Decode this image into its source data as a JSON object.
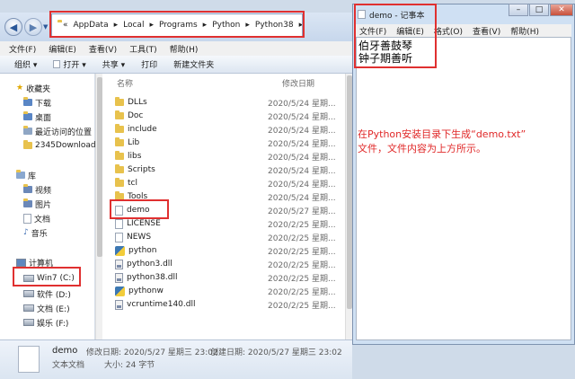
{
  "address_bar": {
    "overflow": "«",
    "segments": [
      "AppData",
      "Local",
      "Programs",
      "Python",
      "Python38"
    ]
  },
  "menu": [
    "文件(F)",
    "编辑(E)",
    "查看(V)",
    "工具(T)",
    "帮助(H)"
  ],
  "toolbar": {
    "organize": "组织 ▾",
    "open": "打开 ▾",
    "share": "共享 ▾",
    "print": "打印",
    "new_folder": "新建文件夹"
  },
  "nav": {
    "favorites": "收藏夹",
    "fav_items": [
      "下载",
      "桌面",
      "最近访问的位置",
      "2345Downloads"
    ],
    "library": "库",
    "lib_items": [
      "视频",
      "图片",
      "文档",
      "音乐"
    ],
    "computer": "计算机",
    "drives": [
      "Win7 (C:)",
      "软件 (D:)",
      "文档 (E:)",
      "娱乐 (F:)"
    ]
  },
  "columns": {
    "name": "名称",
    "date": "修改日期"
  },
  "files": [
    {
      "name": "DLLs",
      "date": "2020/5/24 星期...",
      "kind": "folder"
    },
    {
      "name": "Doc",
      "date": "2020/5/24 星期...",
      "kind": "folder"
    },
    {
      "name": "include",
      "date": "2020/5/24 星期...",
      "kind": "folder"
    },
    {
      "name": "Lib",
      "date": "2020/5/24 星期...",
      "kind": "folder"
    },
    {
      "name": "libs",
      "date": "2020/5/24 星期...",
      "kind": "folder"
    },
    {
      "name": "Scripts",
      "date": "2020/5/24 星期...",
      "kind": "folder"
    },
    {
      "name": "tcl",
      "date": "2020/5/24 星期...",
      "kind": "folder"
    },
    {
      "name": "Tools",
      "date": "2020/5/24 星期...",
      "kind": "folder"
    },
    {
      "name": "demo",
      "date": "2020/5/27 星期...",
      "kind": "doc"
    },
    {
      "name": "LICENSE",
      "date": "2020/2/25 星期...",
      "kind": "doc"
    },
    {
      "name": "NEWS",
      "date": "2020/2/25 星期...",
      "kind": "doc"
    },
    {
      "name": "python",
      "date": "2020/2/25 星期...",
      "kind": "py"
    },
    {
      "name": "python3.dll",
      "date": "2020/2/25 星期...",
      "kind": "dll"
    },
    {
      "name": "python38.dll",
      "date": "2020/2/25 星期...",
      "kind": "dll"
    },
    {
      "name": "pythonw",
      "date": "2020/2/25 星期...",
      "kind": "py"
    },
    {
      "name": "vcruntime140.dll",
      "date": "2020/2/25 星期...",
      "kind": "dll"
    }
  ],
  "details": {
    "name": "demo",
    "type": "文本文档",
    "modified": "修改日期: 2020/5/27 星期三 23:02",
    "created": "创建日期: 2020/5/27 星期三 23:02",
    "size": "大小: 24 字节"
  },
  "notepad": {
    "title": "demo - 记事本",
    "menu": [
      "文件(F)",
      "编辑(E)",
      "格式(O)",
      "查看(V)",
      "帮助(H)"
    ],
    "lines": [
      "伯牙善鼓琴",
      "钟子期善听"
    ],
    "minimize": "–",
    "maximize": "□",
    "close": "✕"
  },
  "annotation": {
    "line1": "在Python安装目录下生成“demo.txt”",
    "line2": "文件，文件内容为上方所示。"
  },
  "colors": {
    "highlight": "#e03030",
    "annotation": "#e02828"
  }
}
